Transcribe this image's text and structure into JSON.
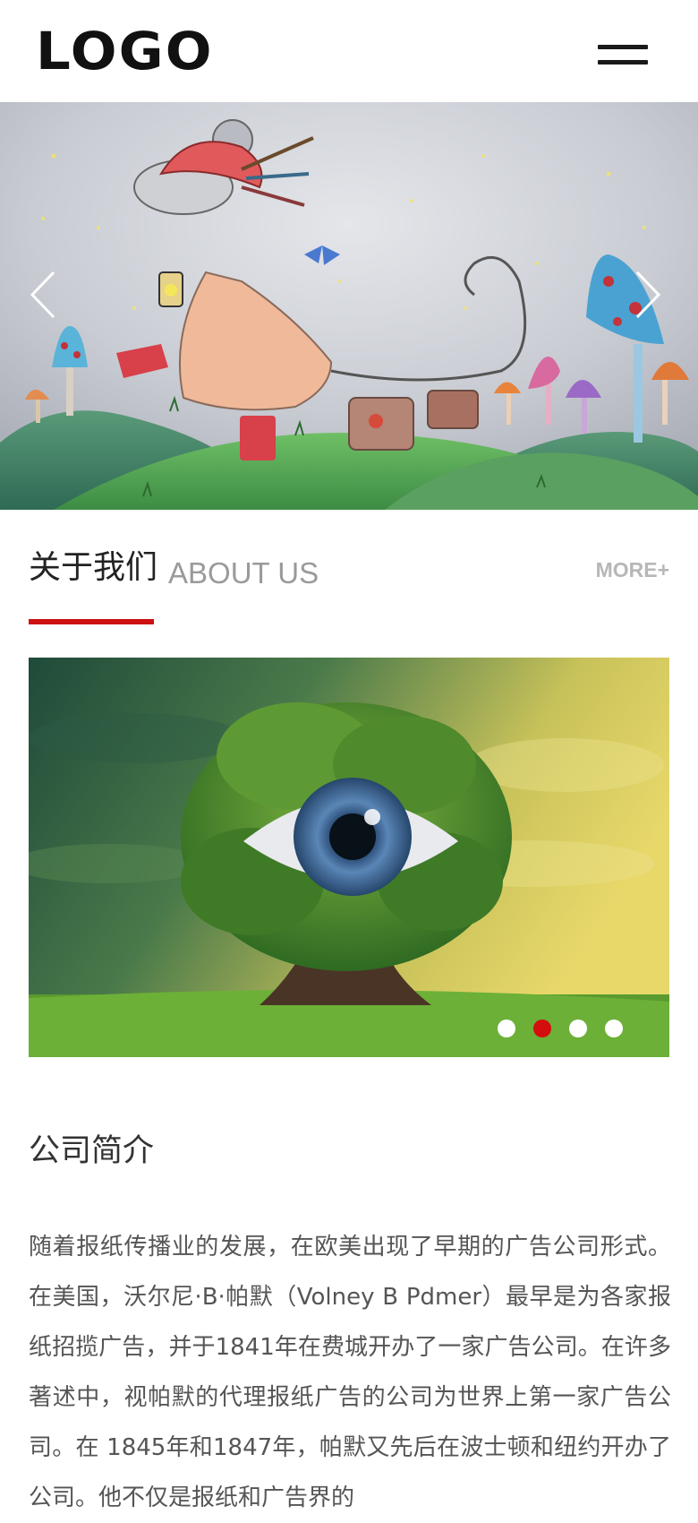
{
  "header": {
    "logo_text": "LOGO",
    "menu_icon": "hamburger-menu-icon"
  },
  "hero": {
    "image_alt": "Illustration of a mouse in a red hat carrying a lantern and suitcase past mushrooms",
    "prev_icon": "chevron-left-icon",
    "next_icon": "chevron-right-icon"
  },
  "about": {
    "title_zh": "关于我们",
    "title_en": "ABOUT US",
    "more_label": "MORE+",
    "accent_color": "#cc1111"
  },
  "carousel": {
    "image_alt": "Tree with a human eye in its foliage against a cloudy yellow sky",
    "dots": [
      {
        "active": false
      },
      {
        "active": true
      },
      {
        "active": false
      },
      {
        "active": false
      }
    ],
    "active_dot_color": "#d40d0d"
  },
  "intro": {
    "title": "公司简介",
    "body": "随着报纸传播业的发展，在欧美出现了早期的广告公司形式。在美国，沃尔尼·B·帕默（Volney B Pdmer）最早是为各家报纸招揽广告，并于1841年在费城开办了一家广告公司。在许多著述中，视帕默的代理报纸广告的公司为世界上第一家广告公司。在 1845年和1847年，帕默又先后在波士顿和纽约开办了公司。他不仅是报纸和广告界的"
  }
}
